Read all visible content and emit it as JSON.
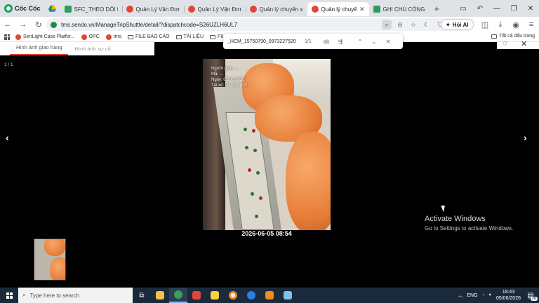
{
  "browser": {
    "brand": "Cốc Cốc",
    "tabs": [
      {
        "label": "SFC_THEO DÕI ĐỔI",
        "icon": "sheets-icon",
        "active": false
      },
      {
        "label": "Quản Lý Vận Đơn C",
        "icon": "sendo-icon",
        "active": false
      },
      {
        "label": "Quản Lý Vận Đơn C",
        "icon": "sendo-icon",
        "active": false
      },
      {
        "label": "Quản lý chuyến xe",
        "icon": "sendo-icon",
        "active": false
      },
      {
        "label": "Quản lý chuyế",
        "icon": "sendo-icon",
        "active": true
      },
      {
        "label": "GHI CHÚ CÔNG VI",
        "icon": "sheets-icon",
        "active": false
      }
    ],
    "url": "tms.sendo.vn/ManageTripShuttle/detail/?dispatchcode=S26UZLH6UL7",
    "hoi_ai_label": "Hỏi AI",
    "bookmarks": [
      {
        "label": "SenLight Case Platfor...",
        "icon": "sendo-icon"
      },
      {
        "label": "OPC",
        "icon": "sendo-icon"
      },
      {
        "label": "tms",
        "icon": "sendo-icon"
      },
      {
        "label": "FILE BÁO CÁO",
        "icon": "folder-icon"
      },
      {
        "label": "TÀI LIỆU",
        "icon": "folder-icon"
      },
      {
        "label": "FILE CÔN",
        "icon": "folder-icon"
      }
    ],
    "all_bookmarks_label": "Tất cả dấu trang"
  },
  "findbar": {
    "query": "_HCM_15750790_0973227520",
    "count": "1/1",
    "ab_label": "ab"
  },
  "page": {
    "tabs": [
      "Hình ảnh giao hàng",
      "Hình ảnh sự cố"
    ],
    "counter": "1 / 1",
    "photo_overlay": [
      "Người giao: ...",
      "Mã: ...",
      "Ngày: 05/06/2026",
      "Tài xế: 0973227520"
    ],
    "photo_date": "2026-06-05 08:54",
    "prev_arrow": "‹",
    "next_arrow": "›"
  },
  "watermark": {
    "title": "Activate Windows",
    "subtitle": "Go to Settings to activate Windows."
  },
  "taskbar": {
    "search_placeholder": "Type here to search",
    "time": "18:43",
    "date": "05/06/2026",
    "notif_count": "26",
    "lang": "ENG"
  }
}
